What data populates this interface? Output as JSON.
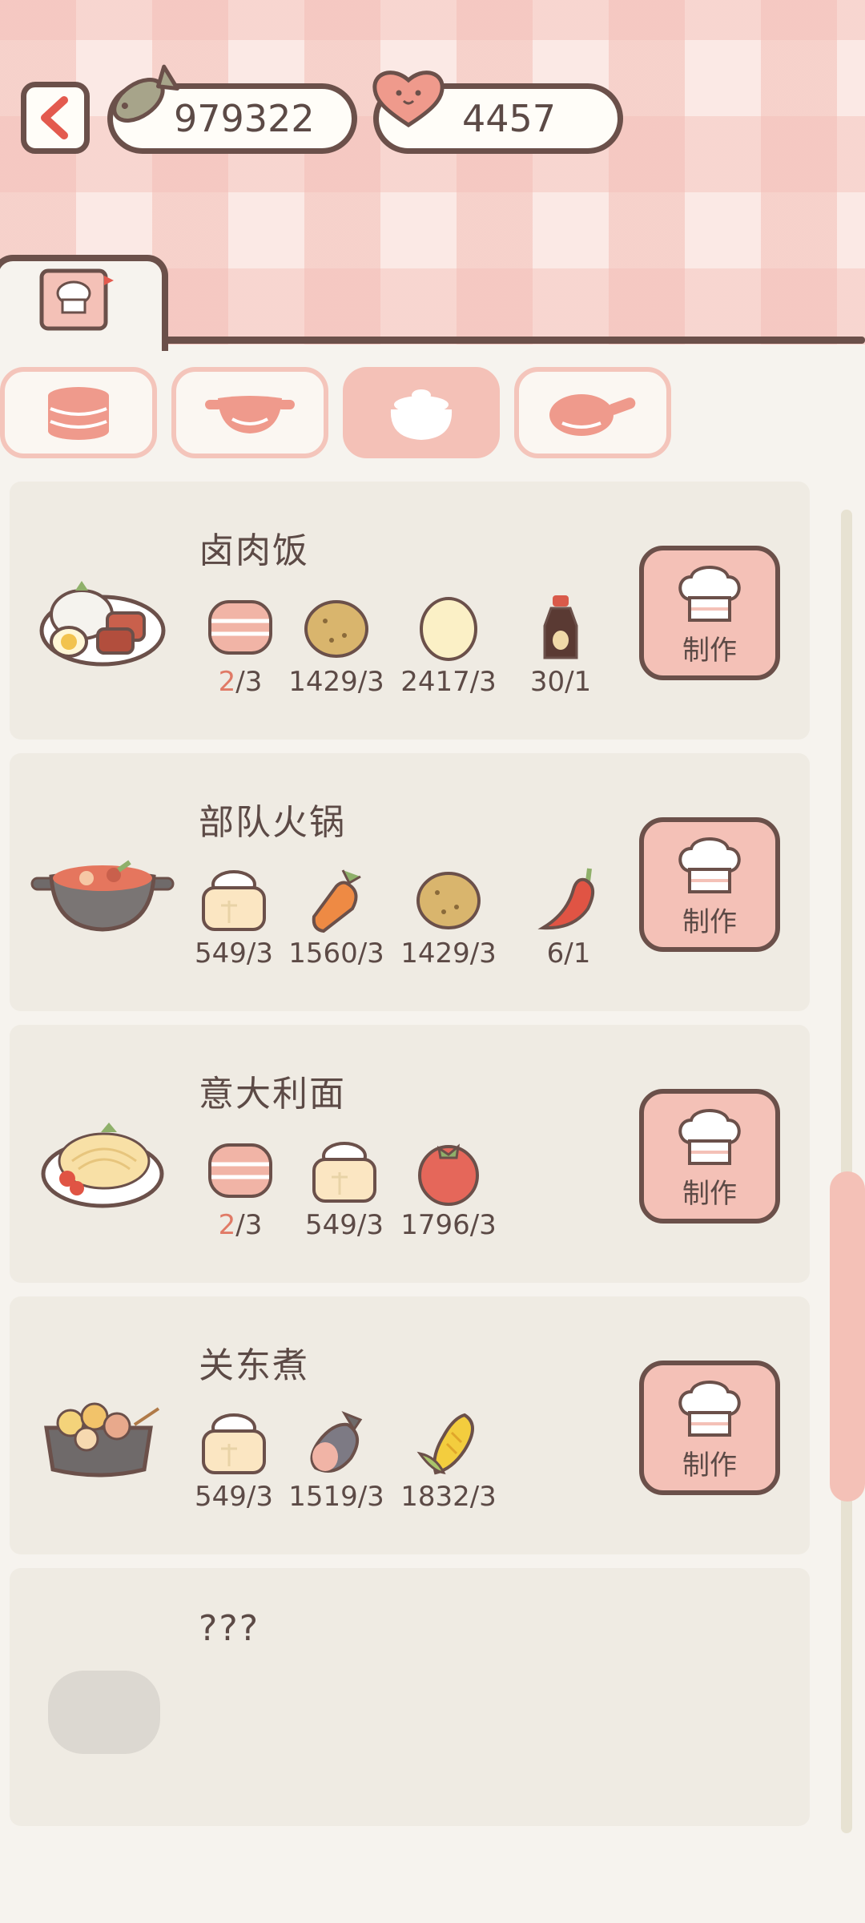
{
  "header": {
    "fish_currency": "979322",
    "heart_currency": "4457"
  },
  "tabs": [
    {
      "icon": "stacked-plate-icon",
      "active": false
    },
    {
      "icon": "wok-pan-icon",
      "active": false
    },
    {
      "icon": "clay-pot-icon",
      "active": true
    },
    {
      "icon": "frying-pan-icon",
      "active": false
    }
  ],
  "recipes": [
    {
      "name": "卤肉饭",
      "dish_icon": "braised-pork-rice-icon",
      "ingredients": [
        {
          "icon": "bacon-slab-icon",
          "have": "2",
          "need": "/3",
          "short": true
        },
        {
          "icon": "potato-icon",
          "have": "1429",
          "need": "/3",
          "short": false
        },
        {
          "icon": "egg-icon",
          "have": "2417",
          "need": "/3",
          "short": false
        },
        {
          "icon": "soy-sauce-icon",
          "have": "30",
          "need": "/1",
          "short": false
        }
      ],
      "button": "制作"
    },
    {
      "name": "部队火锅",
      "dish_icon": "army-stew-icon",
      "ingredients": [
        {
          "icon": "flour-sack-icon",
          "have": "549",
          "need": "/3",
          "short": false
        },
        {
          "icon": "carrot-icon",
          "have": "1560",
          "need": "/3",
          "short": false
        },
        {
          "icon": "potato-icon",
          "have": "1429",
          "need": "/3",
          "short": false
        },
        {
          "icon": "chili-pepper-icon",
          "have": "6",
          "need": "/1",
          "short": false
        }
      ],
      "button": "制作"
    },
    {
      "name": "意大利面",
      "dish_icon": "spaghetti-icon",
      "ingredients": [
        {
          "icon": "bacon-slab-icon",
          "have": "2",
          "need": "/3",
          "short": true
        },
        {
          "icon": "flour-sack-icon",
          "have": "549",
          "need": "/3",
          "short": false
        },
        {
          "icon": "tomato-icon",
          "have": "1796",
          "need": "/3",
          "short": false
        }
      ],
      "button": "制作"
    },
    {
      "name": "关东煮",
      "dish_icon": "oden-icon",
      "ingredients": [
        {
          "icon": "flour-sack-icon",
          "have": "549",
          "need": "/3",
          "short": false
        },
        {
          "icon": "ham-icon",
          "have": "1519",
          "need": "/3",
          "short": false
        },
        {
          "icon": "corn-icon",
          "have": "1832",
          "need": "/3",
          "short": false
        }
      ],
      "button": "制作"
    },
    {
      "name": "???",
      "dish_icon": "locked-dish-icon",
      "ingredients": [],
      "button": ""
    }
  ],
  "colors": {
    "outline": "#6b504a",
    "accent_pink": "#f4c1b7",
    "shortage_red": "#e07a66",
    "card_bg": "#efebe3"
  }
}
